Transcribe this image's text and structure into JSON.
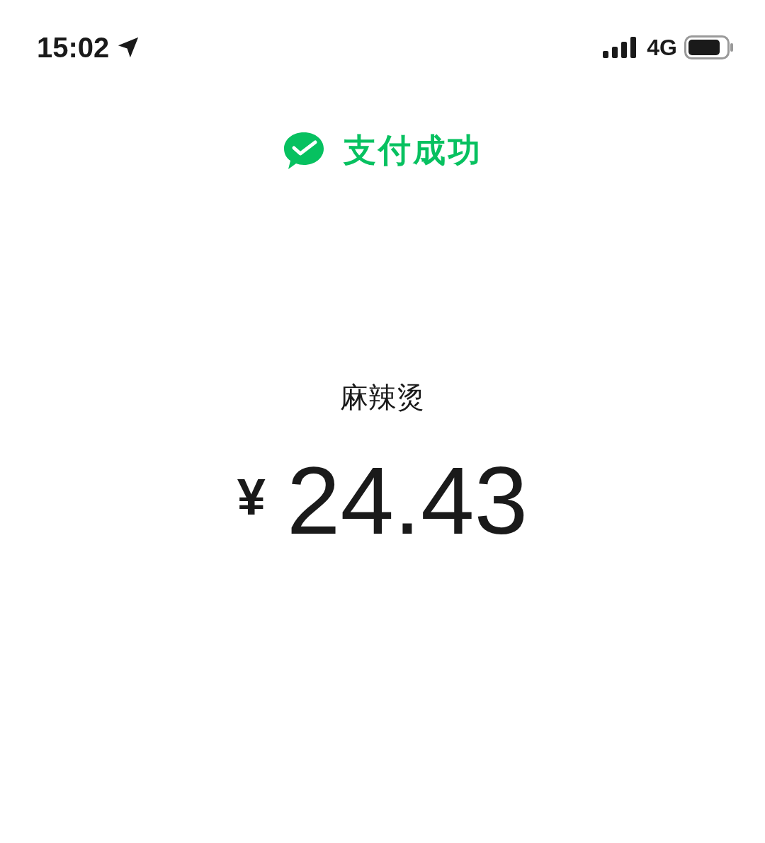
{
  "status_bar": {
    "time": "15:02",
    "network": "4G"
  },
  "header": {
    "title": "支付成功"
  },
  "payment": {
    "merchant": "麻辣烫",
    "currency": "¥",
    "amount": "24.43"
  }
}
